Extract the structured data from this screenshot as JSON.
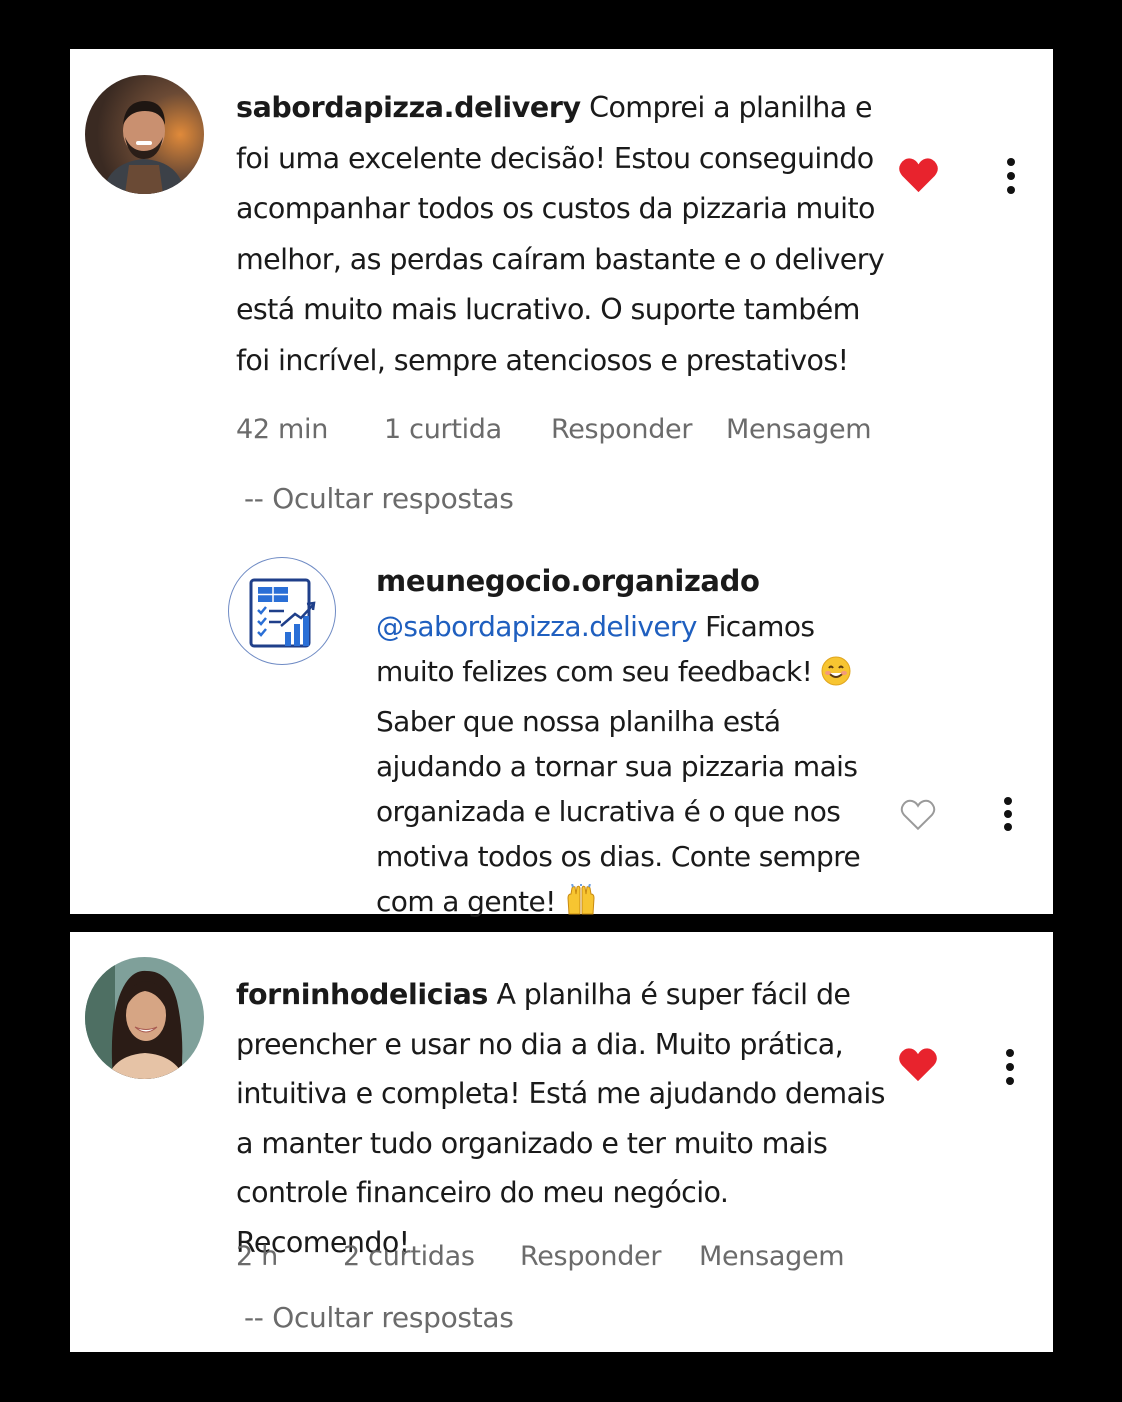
{
  "comments": [
    {
      "username": "sabordapizza.delivery",
      "text": "Comprei a planilha e foi uma excelente decisão! Estou conseguindo acompanhar todos os custos da pizzaria muito melhor, as perdas caíram bastante e o delivery está muito mais lucrativo. O suporte também foi incrível, sempre atenciosos e prestativos!",
      "time": "42 min",
      "likes": "1 curtida",
      "reply_label": "Responder",
      "message_label": "Mensagem",
      "hide_replies": "-- Ocultar respostas",
      "liked": true,
      "reply": {
        "username": "meunegocio.organizado",
        "mention": "@sabordapizza.delivery",
        "text_part1": " Ficamos muito felizes com seu feedback! ",
        "emoji1": "smiling-face-emoji",
        "text_part2": " Saber que nossa planilha está ajudando a tornar sua pizzaria mais organizada e lucrativa é o que nos motiva todos os dias. Conte sempre com a gente! ",
        "emoji2": "raising-hands-emoji",
        "liked": false
      }
    },
    {
      "username": "forninhodelicias",
      "text": "A planilha é super fácil de preencher e usar no dia a dia.  Muito prática, intuitiva e completa! Está me ajudando demais a manter tudo organizado e ter muito mais controle financeiro do meu negócio. Recomendo!",
      "time": "2 h",
      "likes": "2 curtidas",
      "reply_label": "Responder",
      "message_label": "Mensagem",
      "hide_replies": "-- Ocultar respostas",
      "liked": true
    }
  ],
  "colors": {
    "like_red": "#e8232d",
    "mention_blue": "#1f5fbf",
    "meta_gray": "#6b6b6b"
  }
}
